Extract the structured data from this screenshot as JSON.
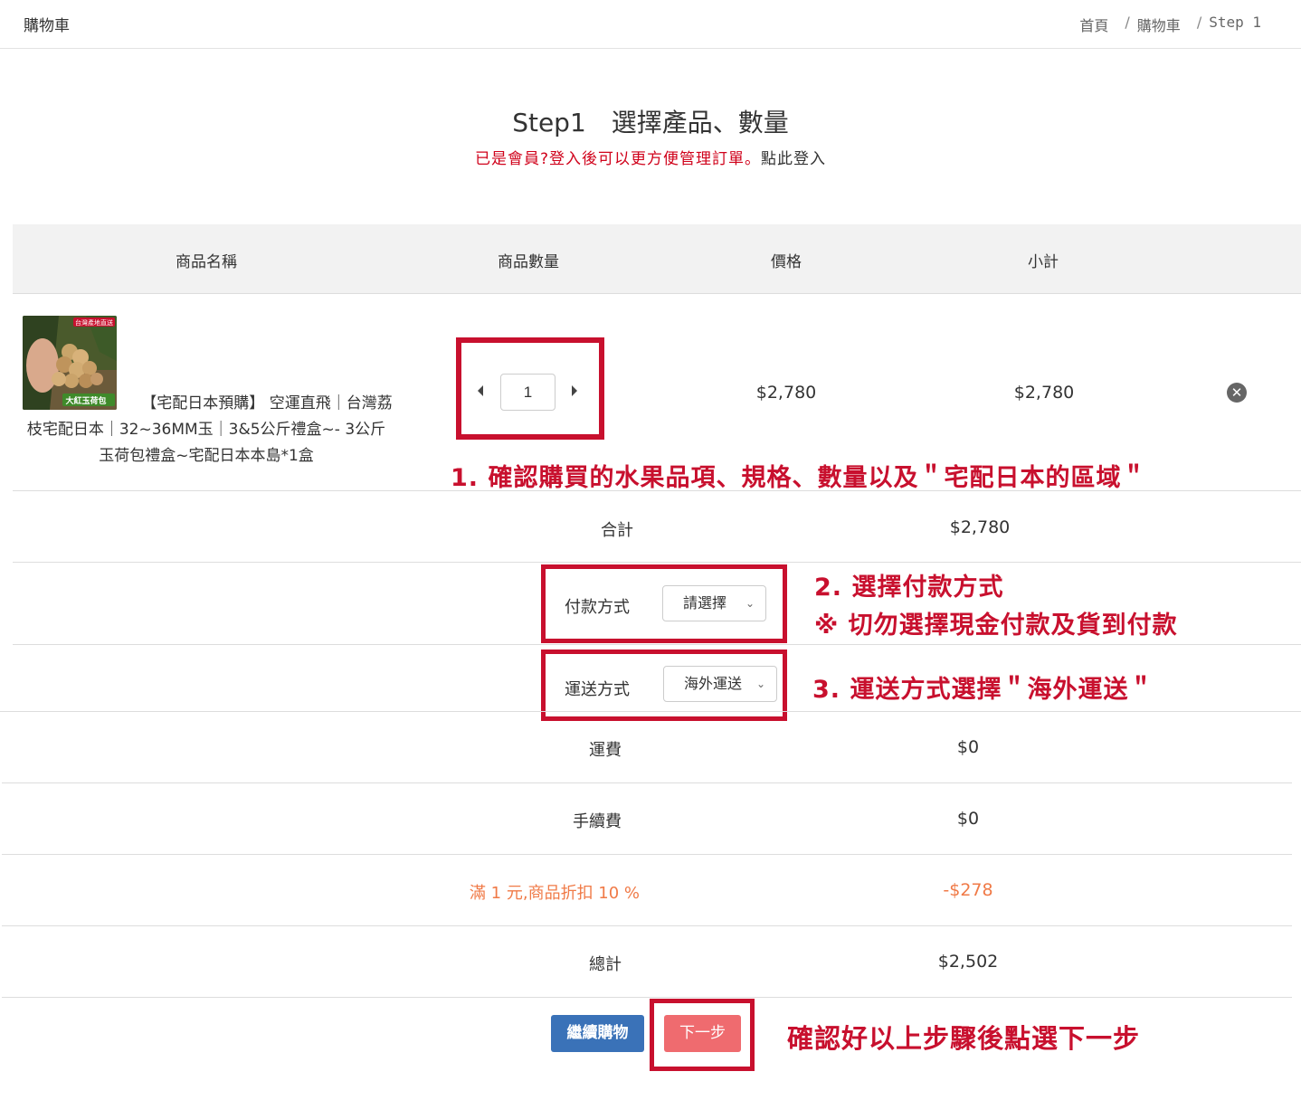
{
  "header": {
    "title": "購物車",
    "breadcrumb": [
      "首頁",
      "購物車",
      "Step 1"
    ]
  },
  "page": {
    "heading": "Step1　選擇產品、數量",
    "login_prompt": "已是會員?登入後可以更方便管理訂單。",
    "login_link": "點此登入"
  },
  "table": {
    "headers": [
      "商品名稱",
      "商品數量",
      "價格",
      "小計"
    ]
  },
  "product": {
    "name": "【宅配日本預購】 空運直飛｜台灣荔枝宅配日本｜32~36MM玉｜3&5公斤禮盒~- 3公斤玉荷包禮盒~宅配日本本島*1盒",
    "image_label": "大紅玉荷包",
    "image_banner": "台灣產地直送",
    "quantity": "1",
    "price": "$2,780",
    "subtotal": "$2,780"
  },
  "summary": {
    "total_label": "合計",
    "total_value": "$2,780",
    "payment_label": "付款方式",
    "payment_value": "請選擇",
    "shipping_label": "運送方式",
    "shipping_value": "海外運送",
    "shipping_fee_label": "運費",
    "shipping_fee_value": "$0",
    "handling_fee_label": "手續費",
    "handling_fee_value": "$0",
    "discount_label": "滿 1 元,商品折扣 10 %",
    "discount_value": "-$278",
    "grand_total_label": "總計",
    "grand_total_value": "$2,502"
  },
  "buttons": {
    "continue": "繼續購物",
    "next": "下一步"
  },
  "annotations": {
    "note1": "1. 確認購買的水果品項、規格、數量以及＂宅配日本的區域＂",
    "note2a": "2. 選擇付款方式",
    "note2b": "※ 切勿選擇現金付款及貨到付款",
    "note3": "3. 運送方式選擇＂海外運送＂",
    "note4": "確認好以上步驟後點選下一步"
  },
  "colors": {
    "annotation_red": "#c8102e",
    "continue_blue": "#3a72b8",
    "next_pink": "#ef6b6f",
    "discount_orange": "#f07a47"
  }
}
